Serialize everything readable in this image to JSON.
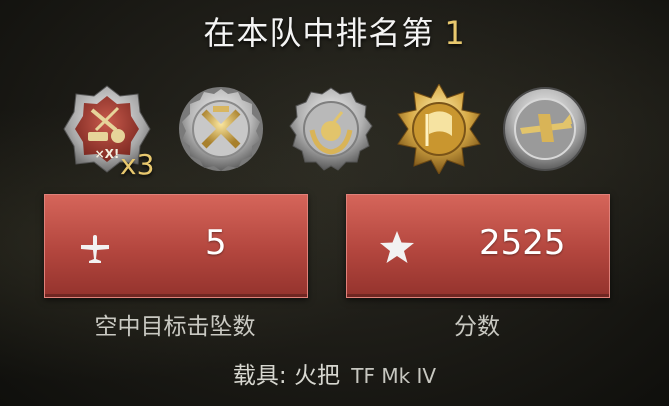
{
  "header": {
    "title": "在本队中排名第",
    "rank": "1"
  },
  "medals": [
    {
      "name": "tank-bomb-medal",
      "count": "x3"
    },
    {
      "name": "crossed-swords-medal"
    },
    {
      "name": "bomb-laurel-medal"
    },
    {
      "name": "flag-medal"
    },
    {
      "name": "plane-medal"
    }
  ],
  "stats": {
    "kills": {
      "icon": "plane-icon",
      "value": "5",
      "label": "空中目标击坠数"
    },
    "score": {
      "icon": "star-icon",
      "value": "2525",
      "label": "分数"
    }
  },
  "vehicle": {
    "prefix": "载具",
    "sep": ": ",
    "name": "火把",
    "model": "TF Mk IV"
  },
  "colors": {
    "accent_gold": "#e8c86e",
    "card_red": "#b3463e"
  }
}
